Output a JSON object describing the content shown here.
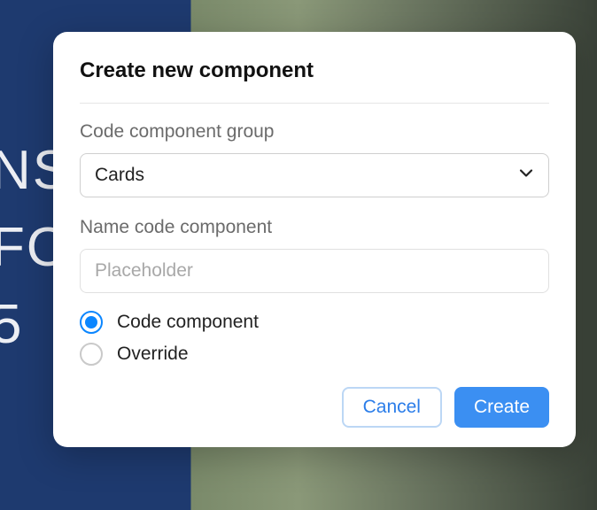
{
  "background": {
    "partial_text": "NS\nFO\n5"
  },
  "modal": {
    "title": "Create new component",
    "group": {
      "label": "Code component group",
      "selected": "Cards"
    },
    "name": {
      "label": "Name code component",
      "value": "",
      "placeholder": "Placeholder"
    },
    "radios": {
      "option1": {
        "label": "Code component",
        "selected": true
      },
      "option2": {
        "label": "Override",
        "selected": false
      }
    },
    "actions": {
      "cancel": "Cancel",
      "create": "Create"
    }
  }
}
